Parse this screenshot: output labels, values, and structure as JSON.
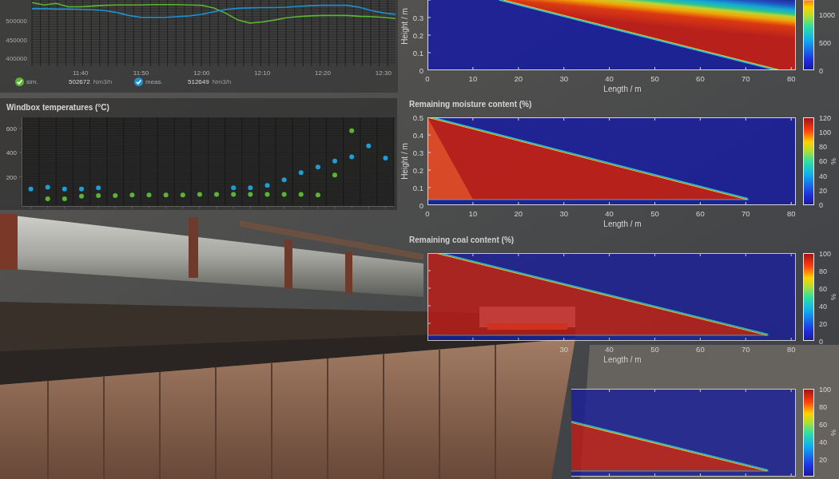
{
  "flow_chart": {
    "chart_data": {
      "type": "line",
      "grid": true,
      "legend": "bottom",
      "categories": [
        null,
        null,
        null,
        null,
        "11:40",
        null,
        null,
        null,
        null,
        "11:50",
        null,
        null,
        null,
        null,
        "12:00",
        null,
        null,
        null,
        null,
        "12:10",
        null,
        null,
        null,
        null,
        "12:20",
        null,
        null,
        null,
        null,
        "12:30",
        null
      ],
      "ylim": [
        386000,
        555000
      ],
      "yticks": [
        400000,
        450000,
        500000
      ],
      "series": [
        {
          "name": "sim.",
          "color": "#5cb531",
          "values": [
            548000,
            542000,
            546000,
            537000,
            537000,
            539000,
            541000,
            542000,
            542000,
            542000,
            543000,
            543000,
            543000,
            542000,
            541000,
            534000,
            520000,
            502000,
            494000,
            497000,
            502000,
            508000,
            511000,
            513000,
            514000,
            514000,
            514000,
            512000,
            511000,
            509000,
            506000
          ]
        },
        {
          "name": "meas.",
          "color": "#1e90cf",
          "values": [
            532000,
            532000,
            531000,
            531000,
            530000,
            529000,
            527000,
            522000,
            514000,
            509000,
            509000,
            509000,
            511000,
            513000,
            517000,
            524000,
            530000,
            533000,
            534000,
            535000,
            535000,
            536000,
            538000,
            540000,
            541000,
            541000,
            541000,
            536000,
            527000,
            521000,
            517000
          ]
        }
      ]
    },
    "legend_entries": [
      {
        "checked": true,
        "value": "502672",
        "unit": "Nm3/h"
      },
      {
        "checked": true,
        "value": "512649",
        "unit": "Nm3/h"
      }
    ]
  },
  "windbox_chart": {
    "title": "Windbox temperatures (°C)",
    "chart_data": {
      "type": "scatter",
      "grid": true,
      "categories": [
        null,
        null,
        null,
        null,
        null,
        null,
        null,
        null,
        null,
        null,
        null,
        null,
        null,
        null,
        null,
        null,
        null,
        null,
        null,
        null,
        null,
        null
      ],
      "ylim": [
        -40,
        690
      ],
      "yticks": [
        200,
        400,
        600
      ],
      "series": [
        {
          "color": "#1d9fd6",
          "values": [
            100,
            115,
            100,
            100,
            110,
            null,
            null,
            null,
            null,
            null,
            null,
            null,
            110,
            110,
            130,
            175,
            235,
            280,
            330,
            365,
            455,
            355
          ]
        },
        {
          "color": "#5cb531",
          "values": [
            null,
            20,
            20,
            40,
            45,
            45,
            50,
            50,
            50,
            50,
            55,
            55,
            55,
            55,
            55,
            55,
            55,
            50,
            215,
            580,
            null,
            null
          ]
        }
      ]
    }
  },
  "heatmaps": [
    {
      "kind": "band",
      "ylabel": "Height / m",
      "yticks": [
        "0.3",
        "0.2",
        "0.1",
        "0"
      ],
      "xticks": [
        "0",
        "10",
        "20",
        "30",
        "40",
        "50",
        "60",
        "70",
        "80"
      ],
      "xlabel": "Length / m",
      "colorbar_ticks": [
        "1000",
        "500",
        "0"
      ]
    },
    {
      "kind": "wedge",
      "title": "Remaining moisture content (%)",
      "ylabel": "Height / m",
      "yticks": [
        "0.5",
        "0.4",
        "0.3",
        "0.2",
        "0.1",
        "0"
      ],
      "xticks": [
        "0",
        "10",
        "20",
        "30",
        "40",
        "50",
        "60",
        "70",
        "80"
      ],
      "xlabel": "Length / m",
      "colorbar_ticks": [
        "120",
        "100",
        "80",
        "60",
        "40",
        "20",
        "0"
      ],
      "unit": "%"
    },
    {
      "kind": "front",
      "title": "Remaining coal content (%)",
      "xticks": [
        "30",
        "40",
        "50",
        "60",
        "70",
        "80"
      ],
      "xlabel": "Length / m",
      "colorbar_ticks": [
        "100",
        "80",
        "60",
        "40",
        "20",
        "0"
      ],
      "unit": "%"
    },
    {
      "kind": "front",
      "colorbar_ticks": [
        "100",
        "80",
        "60",
        "40",
        "20"
      ],
      "unit": "%"
    }
  ]
}
